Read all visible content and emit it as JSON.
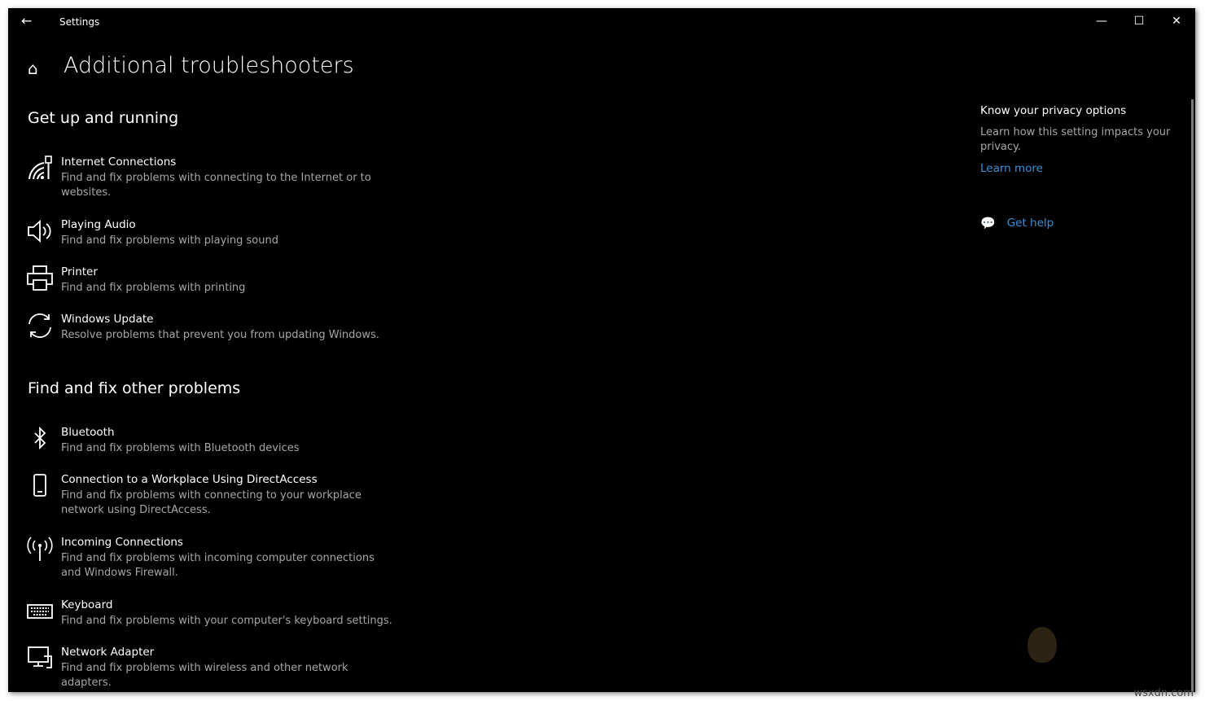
{
  "window": {
    "title": "Settings",
    "back_icon": "arrow-left-icon",
    "controls": [
      "minimize-icon",
      "maximize-icon",
      "close-icon"
    ]
  },
  "page": {
    "title": "Additional troubleshooters",
    "home_icon": "home-icon"
  },
  "sections": [
    {
      "heading": "Get up and running",
      "items": [
        {
          "icon": "internet-connections-icon",
          "title": "Internet Connections",
          "desc": "Find and fix problems with connecting to the Internet or to websites."
        },
        {
          "icon": "speaker-icon",
          "title": "Playing Audio",
          "desc": "Find and fix problems with playing sound"
        },
        {
          "icon": "printer-icon",
          "title": "Printer",
          "desc": "Find and fix problems with printing"
        },
        {
          "icon": "sync-icon",
          "title": "Windows Update",
          "desc": "Resolve problems that prevent you from updating Windows."
        }
      ]
    },
    {
      "heading": "Find and fix other problems",
      "items": [
        {
          "icon": "bluetooth-icon",
          "title": "Bluetooth",
          "desc": "Find and fix problems with Bluetooth devices"
        },
        {
          "icon": "phone-icon",
          "title": "Connection to a Workplace Using DirectAccess",
          "desc": "Find and fix problems with connecting to your workplace network using DirectAccess."
        },
        {
          "icon": "antenna-icon",
          "title": "Incoming Connections",
          "desc": "Find and fix problems with incoming computer connections and Windows Firewall."
        },
        {
          "icon": "keyboard-icon",
          "title": "Keyboard",
          "desc": "Find and fix problems with your computer's keyboard settings."
        },
        {
          "icon": "network-adapter-icon",
          "title": "Network Adapter",
          "desc": "Find and fix problems with wireless and other network adapters."
        }
      ]
    }
  ],
  "sidebar": {
    "heading": "Know your privacy options",
    "text": "Learn how this setting impacts your privacy.",
    "learn_more": "Learn more",
    "get_help": "Get help",
    "link_color": "#3a8fd8"
  },
  "watermark": "wsxdn.com"
}
